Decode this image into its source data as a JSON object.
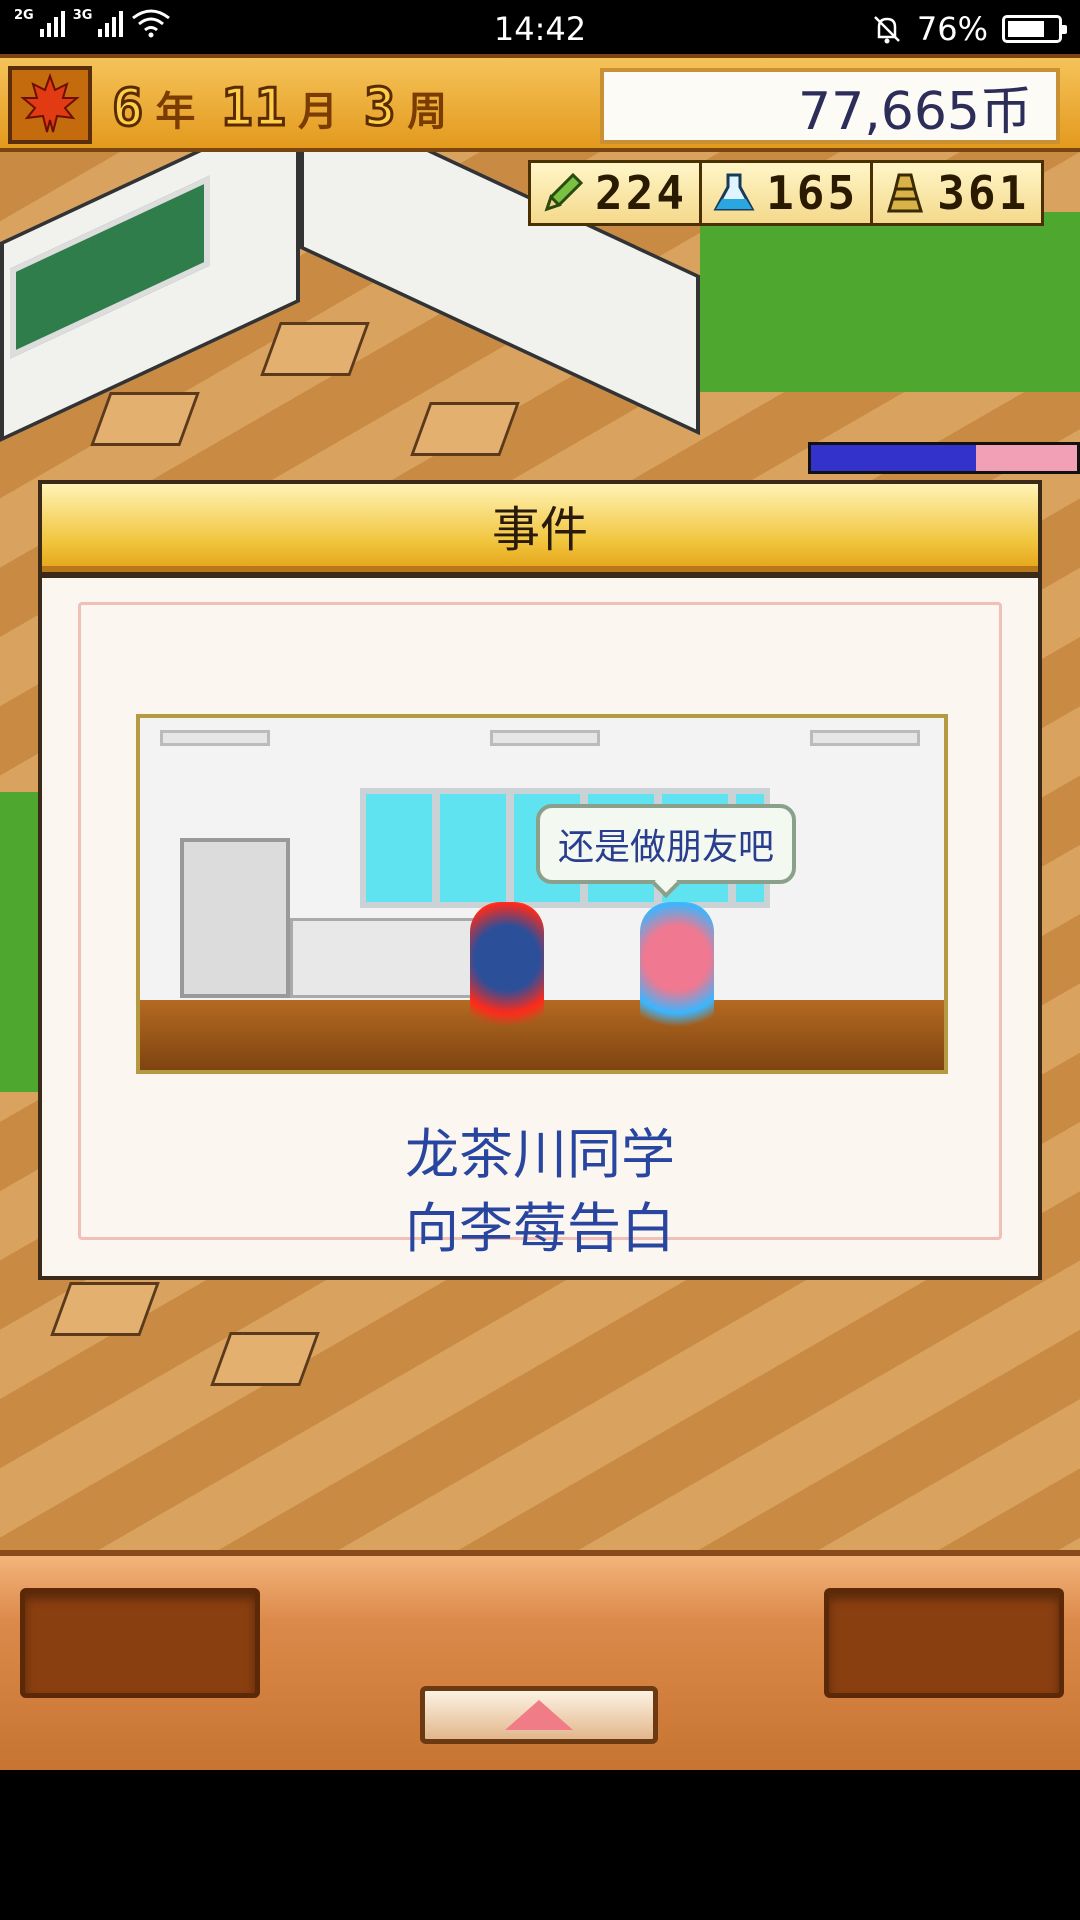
{
  "status_bar": {
    "network_1": "2G",
    "network_2": "3G",
    "time": "14:42",
    "battery": "76%",
    "battery_level": 0.76
  },
  "hud": {
    "season_icon": "maple-leaf-icon",
    "year": "6",
    "year_unit": "年",
    "month": "11",
    "month_unit": "月",
    "week": "3",
    "week_unit": "周",
    "money": "77,665币"
  },
  "stats": [
    {
      "icon": "pencil-icon",
      "value": "224"
    },
    {
      "icon": "flask-icon",
      "value": "165"
    },
    {
      "icon": "trophy-icon",
      "value": "361"
    }
  ],
  "event_dialog": {
    "title": "事件",
    "speech_bubble": "还是做朋友吧",
    "message_line1": "龙茶川同学",
    "message_line2": "向李莓告白"
  },
  "colors": {
    "hud_gold": "#f0b040",
    "dialog_text": "#2845a0",
    "boy_aura": "#ff2a1a",
    "girl_aura": "#3ab6ff",
    "panel_orange": "#dc8a4b"
  },
  "bottom_panel": {
    "up_button_icon": "up-arrow-icon"
  }
}
